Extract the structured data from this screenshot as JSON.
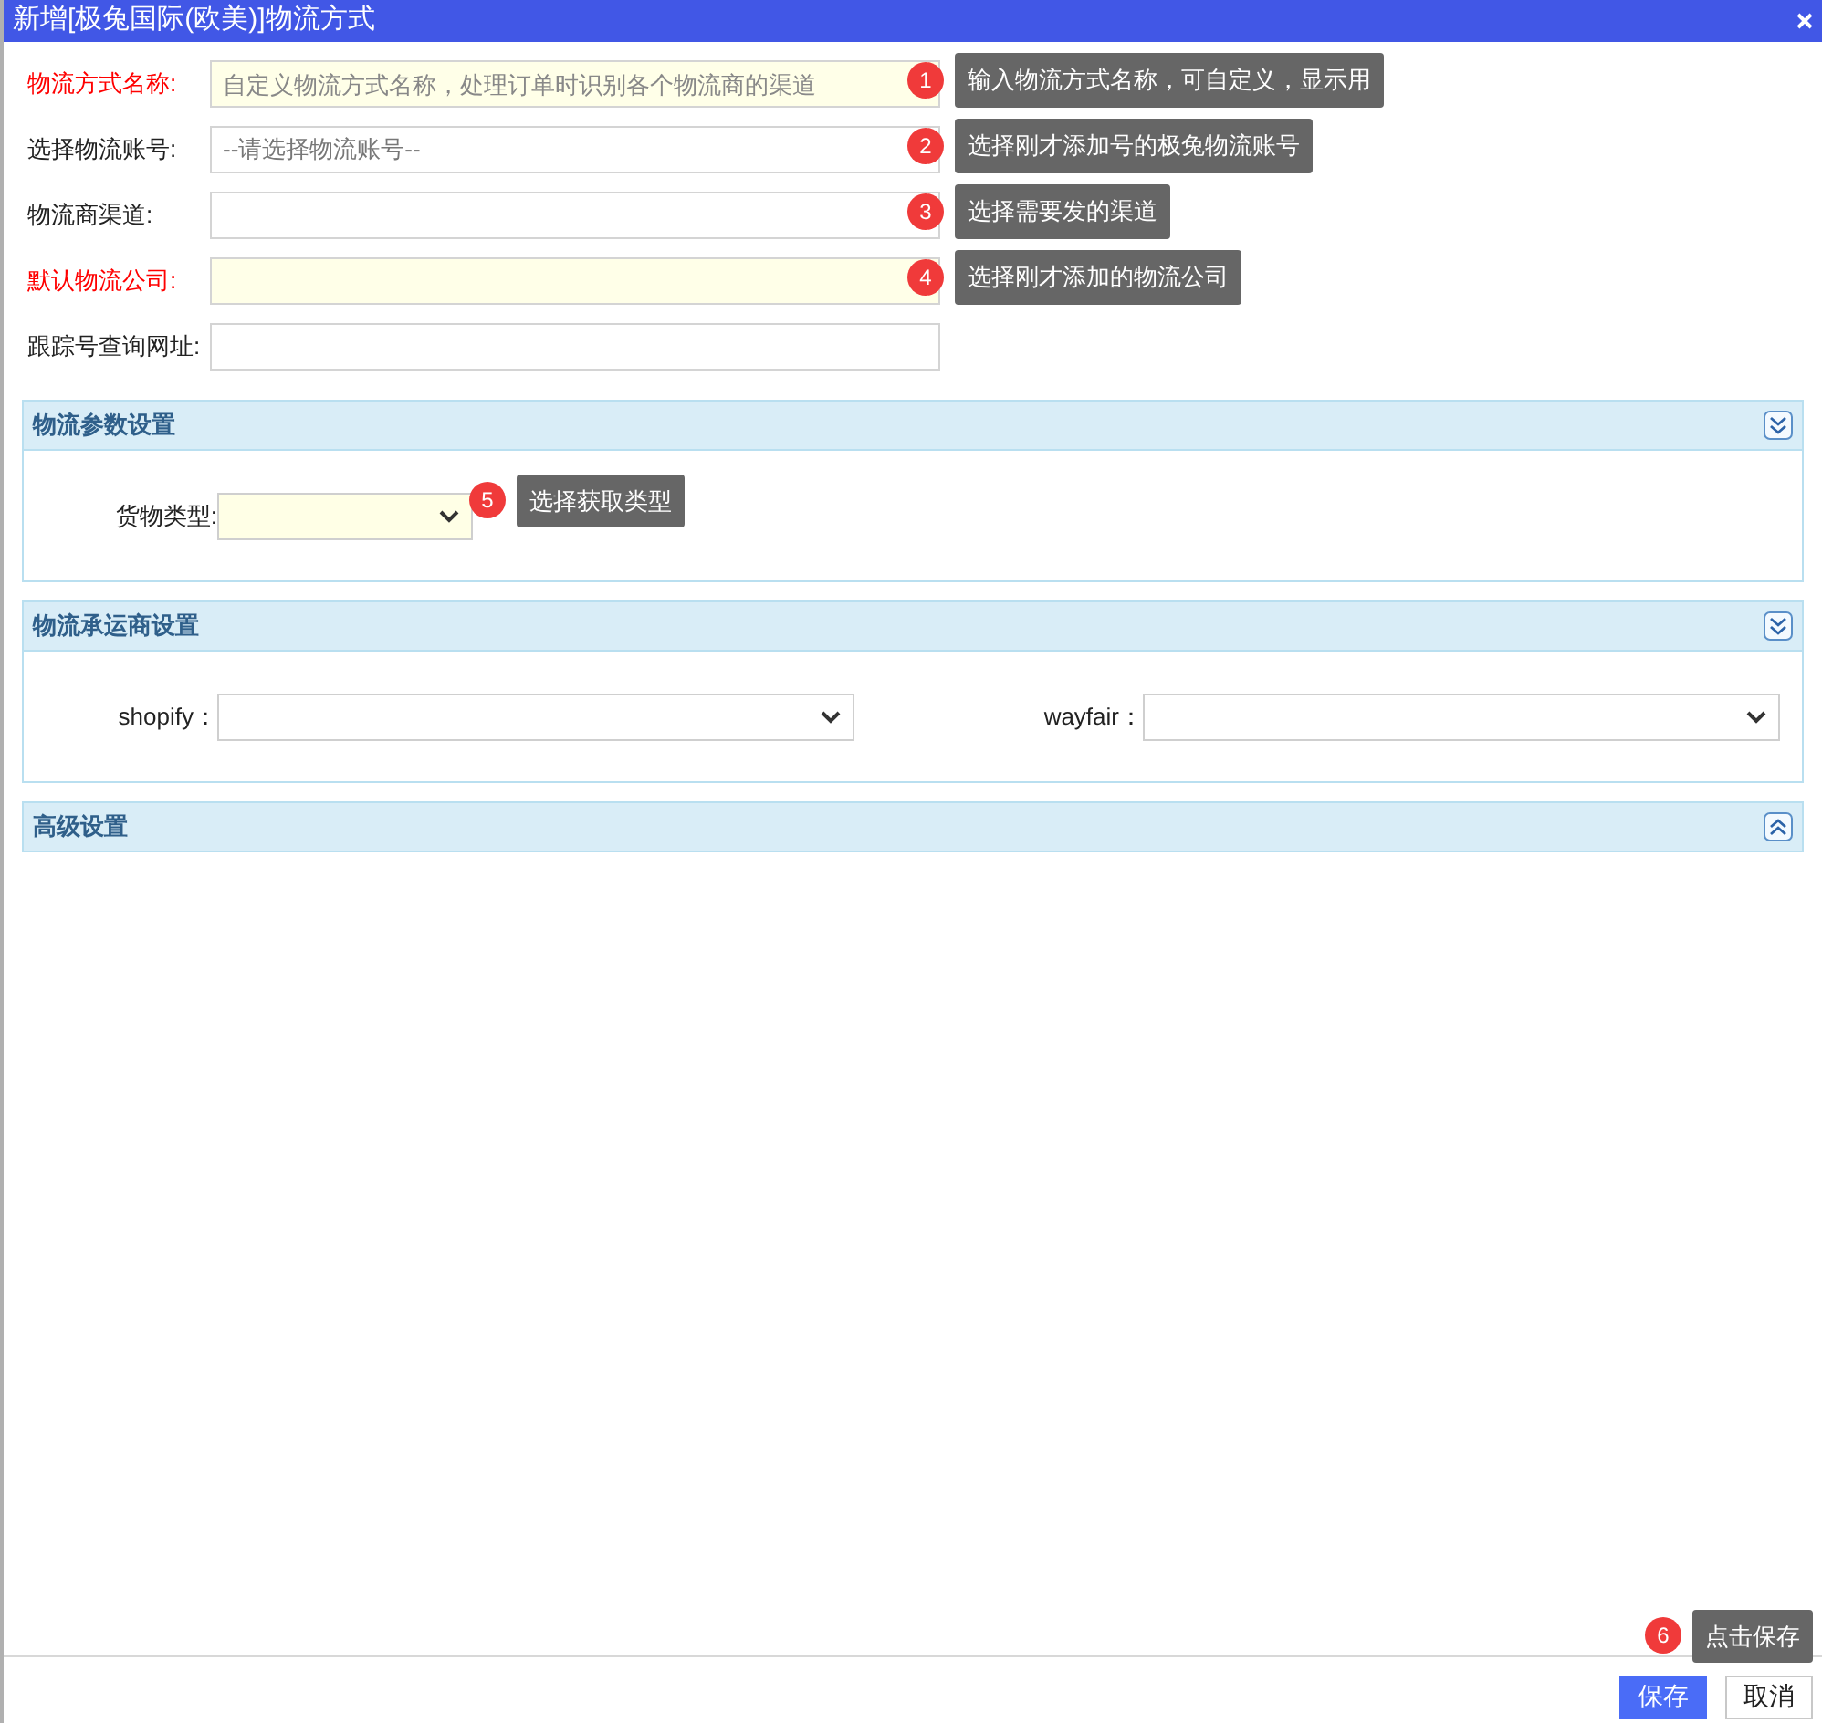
{
  "window": {
    "title": "新增[极兔国际(欧美)]物流方式"
  },
  "fields": [
    {
      "label": "物流方式名称:",
      "required": true,
      "kind": "input",
      "placeholder": "自定义物流方式名称，处理订单时识别各个物流商的渠道",
      "hint": {
        "number": "1",
        "text": "输入物流方式名称，可自定义，显示用"
      }
    },
    {
      "label": "选择物流账号:",
      "required": false,
      "kind": "select",
      "placeholder": "--请选择物流账号--",
      "hint": {
        "number": "2",
        "text": "选择刚才添加号的极兔物流账号"
      }
    },
    {
      "label": "物流商渠道:",
      "required": false,
      "kind": "input",
      "hint": {
        "number": "3",
        "text": "选择需要发的渠道"
      }
    },
    {
      "label": "默认物流公司:",
      "required": true,
      "kind": "input",
      "hint": {
        "number": "4",
        "text": "选择刚才添加的物流公司"
      }
    },
    {
      "label": "跟踪号查询网址:",
      "required": false,
      "kind": "input"
    }
  ],
  "sections": [
    {
      "title": "物流参数设置",
      "expanded": true,
      "fields": [
        {
          "label": "货物类型:",
          "required": true,
          "hint": {
            "number": "5",
            "text": "选择获取类型"
          }
        }
      ]
    },
    {
      "title": "物流承运商设置",
      "expanded": true,
      "fields": [
        {
          "label": "shopify：",
          "required": false
        },
        {
          "label": "wayfair：",
          "required": false
        }
      ]
    },
    {
      "title": "高级设置",
      "expanded": false
    }
  ],
  "buttons": [
    {
      "label": "保存",
      "kind": "primary",
      "hint": {
        "number": "6",
        "text": "点击保存"
      }
    },
    {
      "label": "取消",
      "kind": "secondary"
    }
  ]
}
